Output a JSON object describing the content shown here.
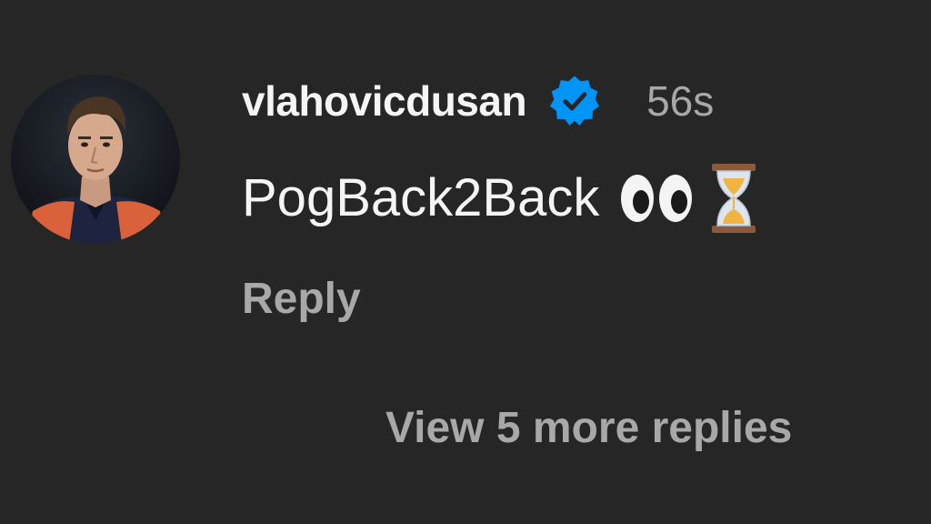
{
  "comment": {
    "username": "vlahovicdusan",
    "timestamp": "56s",
    "text": "PogBack2Back",
    "emojis": [
      "eyes-emoji",
      "hourglass-emoji"
    ],
    "reply_label": "Reply",
    "view_more_label": "View 5 more replies",
    "verified": true
  },
  "colors": {
    "background": "#262626",
    "primary_text": "#f5f5f5",
    "secondary_text": "#a8a8a8",
    "verified_blue": "#0095f6"
  }
}
